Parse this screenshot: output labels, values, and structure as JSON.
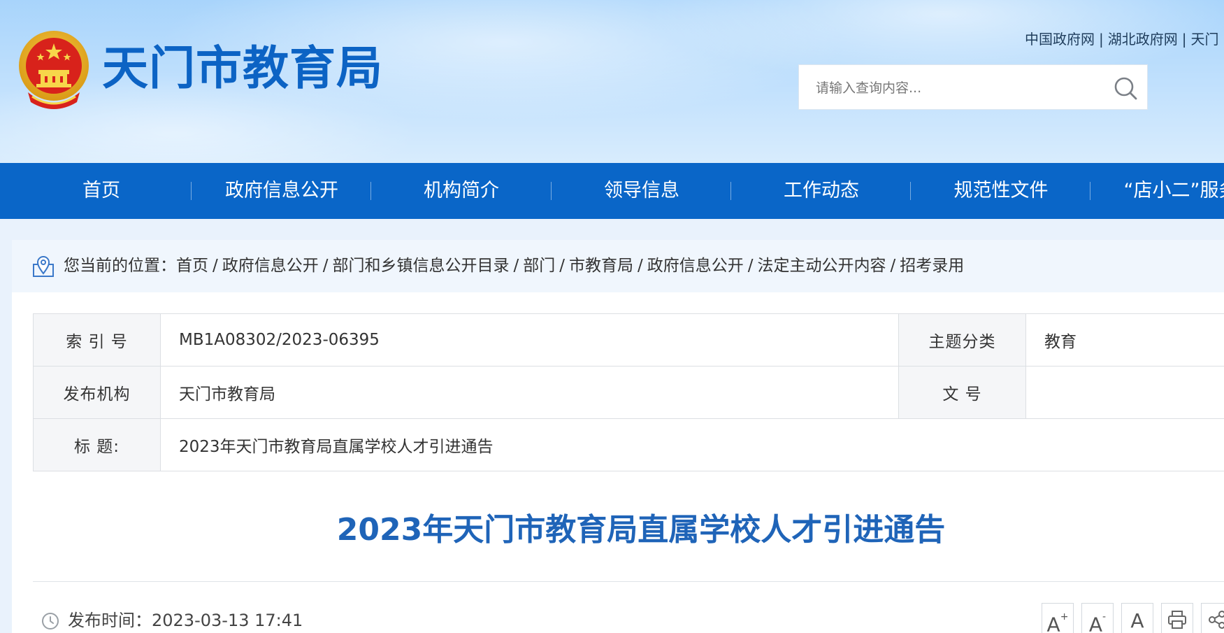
{
  "header": {
    "site_title": "天门市教育局",
    "top_links": [
      "中国政府网",
      "湖北政府网",
      "天门"
    ],
    "search": {
      "placeholder": "请输入查询内容..."
    }
  },
  "nav": {
    "items": [
      "首页",
      "政府信息公开",
      "机构简介",
      "领导信息",
      "工作动态",
      "规范性文件",
      "“店小二”服务"
    ]
  },
  "breadcrumb": {
    "prefix": "您当前的位置：",
    "items": [
      "首页",
      "政府信息公开",
      "部门和乡镇信息公开目录",
      "部门",
      "市教育局",
      "政府信息公开",
      "法定主动公开内容",
      "招考录用"
    ]
  },
  "meta": {
    "index_label": "索 引 号",
    "index_value": "MB1A08302/2023-06395",
    "topic_label": "主题分类",
    "topic_value": "教育",
    "org_label": "发布机构",
    "org_value": "天门市教育局",
    "docno_label": "文 号",
    "docno_value": "",
    "title_label": "标 题:",
    "title_value": "2023年天门市教育局直属学校人才引进通告"
  },
  "article": {
    "title": "2023年天门市教育局直属学校人才引进通告",
    "publish_label": "发布时间：",
    "publish_time": "2023-03-13 17:41"
  },
  "tools": {
    "font_up": "A",
    "font_up_sup": "+",
    "font_down": "A",
    "font_down_sup": "-",
    "font_reset": "A"
  },
  "colors": {
    "brand_blue": "#0a66c8",
    "title_blue": "#1f64b8"
  }
}
